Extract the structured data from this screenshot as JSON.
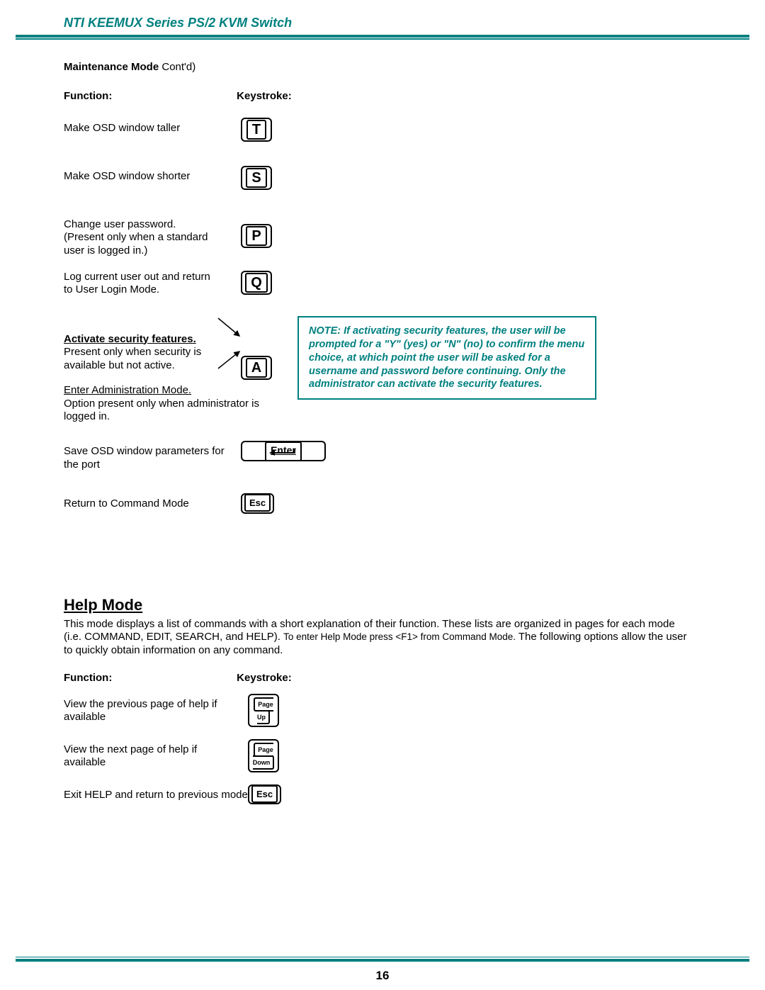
{
  "header": {
    "title": "NTI KEEMUX Series   PS/2 KVM Switch"
  },
  "maintenance_mode": {
    "subtitle_bold": "Maintenance Mode",
    "subtitle_suffix": " Cont'd)",
    "col_function": "Function:",
    "col_keystroke": "Keystroke:",
    "rows": [
      {
        "func": "Make OSD window taller",
        "key": "T"
      },
      {
        "func": "Make OSD window shorter",
        "key": "S"
      },
      {
        "func": "Change user password.\n(Present only when a standard user is logged in.)",
        "key": "P"
      },
      {
        "func": "Log current user out and return to User Login Mode.",
        "key": "Q"
      }
    ],
    "security": {
      "heading": "Activate security features.",
      "line1": "Present only when security is available but not active.",
      "key": "A",
      "admin_heading": "Enter Administration Mode.",
      "admin_line": "Option present only when administrator is logged in."
    },
    "save_row": {
      "func": "Save OSD window parameters for the port",
      "key": "Enter"
    },
    "return_row": {
      "func": "Return to Command Mode",
      "key": "Esc"
    }
  },
  "note_box": {
    "text": "NOTE: If activating security features, the user will be prompted for a \"Y\" (yes) or \"N\" (no) to confirm the menu choice, at which point the user will be asked for a username and password before continuing.   Only the administrator can activate the security features."
  },
  "help_mode": {
    "heading": "Help Mode",
    "para_part1": "This mode displays a list of commands with a short explanation of their function.  These lists are organized in pages for each mode (i.e. COMMAND, EDIT, SEARCH, and HELP). ",
    "para_small": "To enter Help Mode press <F1> from Command Mode.",
    "para_part2": "  The following options allow the user to quickly obtain information on any command.",
    "col_function": "Function:",
    "col_keystroke": "Keystroke:",
    "rows": [
      {
        "func": "View the previous page of help if available",
        "key1": "Page",
        "key2": "Up"
      },
      {
        "func": "View the next page of help if available",
        "key1": "Page",
        "key2": "Down"
      },
      {
        "func": "Exit HELP and return to previous mode",
        "key_esc": "Esc"
      }
    ]
  },
  "page_number": "16"
}
